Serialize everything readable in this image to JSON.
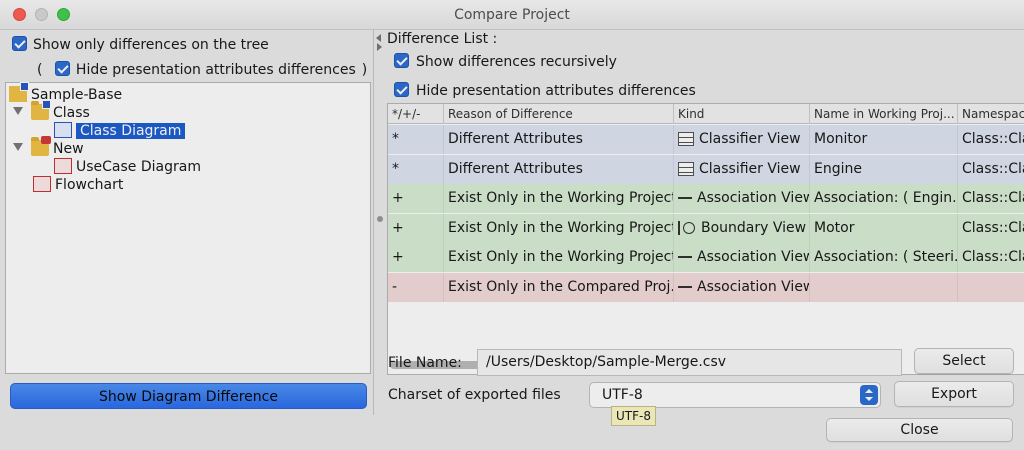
{
  "window": {
    "title": "Compare Project"
  },
  "left": {
    "show_only_diff_label": "Show only differences on the tree",
    "paren_open": "(",
    "paren_close": ")",
    "hide_presentation_label": "Hide presentation attributes differences",
    "tree": [
      {
        "label": "Sample-Base",
        "icon": "project-icon"
      },
      {
        "label": "Class",
        "icon": "folder-class-icon"
      },
      {
        "label": "Class Diagram",
        "icon": "class-diagram-icon",
        "selected": true
      },
      {
        "label": "New",
        "icon": "folder-new-icon"
      },
      {
        "label": "UseCase Diagram",
        "icon": "usecase-diagram-icon"
      },
      {
        "label": "Flowchart",
        "icon": "flowchart-icon"
      }
    ],
    "show_diagram_button": "Show Diagram Difference"
  },
  "right": {
    "title": "Difference List :",
    "recursive_label": "Show differences recursively",
    "hide_presentation_label": "Hide presentation attributes differences",
    "columns": [
      "*/+/-",
      "Reason of Difference",
      "Kind",
      "Name in Working Proj...",
      "Namespac"
    ],
    "rows": [
      {
        "op": "*",
        "reason": "Different Attributes",
        "kind": "Classifier View",
        "kind_icon": "classifier-view-icon",
        "name": "Monitor",
        "ns": "Class::Cla",
        "color": "#dfe6f3"
      },
      {
        "op": "*",
        "reason": "Different Attributes",
        "kind": "Classifier View",
        "kind_icon": "classifier-view-icon",
        "name": "Engine",
        "ns": "Class::Cla",
        "color": "#dfe6f3"
      },
      {
        "op": "+",
        "reason": "Exist Only in the Working Project",
        "kind": "Association View",
        "kind_icon": "association-view-icon",
        "name": "Association: ( Engin...",
        "ns": "Class::Cla",
        "color": "#d9eed7"
      },
      {
        "op": "+",
        "reason": "Exist Only in the Working Project",
        "kind": "Boundary View",
        "kind_icon": "boundary-view-icon",
        "name": "Motor",
        "ns": "Class::Cla",
        "color": "#d9eed7"
      },
      {
        "op": "+",
        "reason": "Exist Only in the Working Project",
        "kind": "Association View",
        "kind_icon": "association-view-icon",
        "name": "Association: ( Steeri...",
        "ns": "Class::Cla",
        "color": "#d9eed7"
      },
      {
        "op": "-",
        "reason": "Exist Only in the Compared Proj...",
        "kind": "Association View",
        "kind_icon": "association-view-icon",
        "name": "",
        "ns": "",
        "color": "#f4dcdc"
      }
    ],
    "file_name_label": "File Name:",
    "file_name_value": "/Users/Desktop/Sample-Merge.csv",
    "select_button": "Select",
    "charset_label": "Charset of exported files",
    "charset_value": "UTF-8",
    "export_button": "Export",
    "tooltip": "UTF-8",
    "close_button": "Close"
  }
}
